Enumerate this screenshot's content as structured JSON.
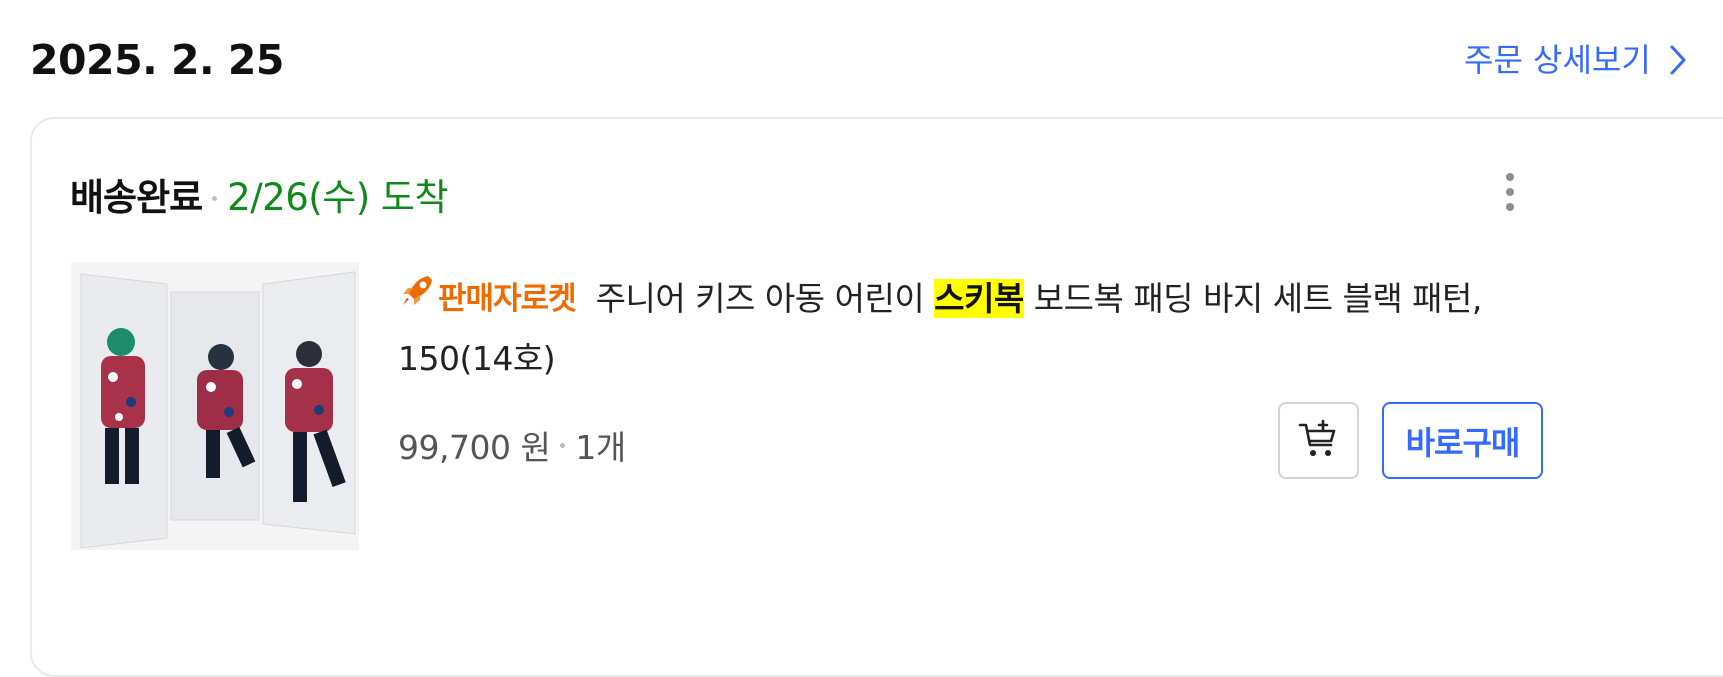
{
  "order": {
    "date": "2025. 2. 25",
    "detail_link_label": "주문 상세보기"
  },
  "card": {
    "status": "배송완료",
    "arrival": "2/26(수) 도착",
    "product": {
      "badge_label": "판매자로켓",
      "title_before": "주니어 키즈 아동 어린이 ",
      "title_highlight": "스키복",
      "title_after": " 보드복 패딩 바지 세트 블랙 패턴, 150(14호)",
      "price": "99,700 원",
      "quantity": "1개"
    },
    "buy_button_label": "바로구매"
  },
  "colors": {
    "link": "#346aff",
    "arrival_green": "#0e8a1b",
    "rocket_orange": "#ef6b00",
    "highlight": "#ffff00"
  },
  "icons": [
    "chevron-right-icon",
    "more-vertical-icon",
    "rocket-icon",
    "add-to-cart-icon"
  ]
}
